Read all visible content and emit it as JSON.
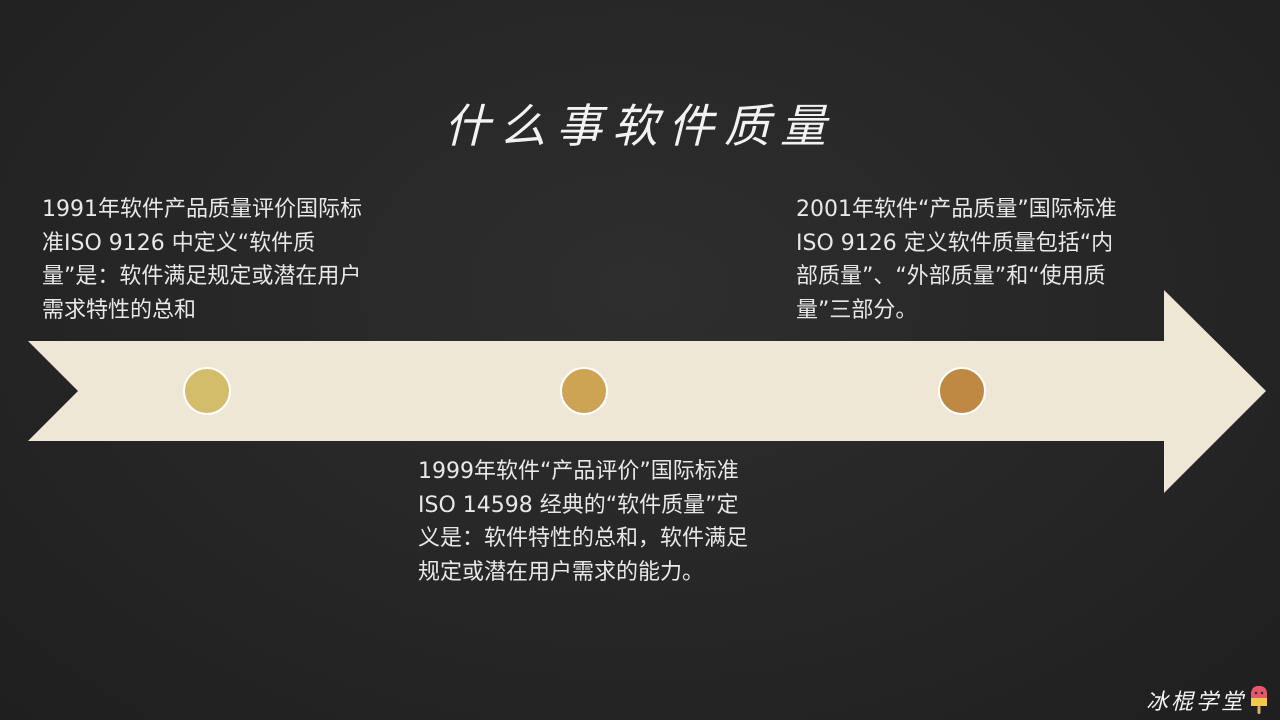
{
  "title": "什么事软件质量",
  "timeline": {
    "events": [
      {
        "text": "1991年软件产品质量评价国际标准ISO 9126 中定义“软件质量”是：软件满足规定或潜在用户需求特性的总和",
        "dot_color": "#d4bd6a"
      },
      {
        "text": "1999年软件“产品评价”国际标准ISO 14598 经典的“软件质量”定义是：软件特性的总和，软件满足规定或潜在用户需求的能力。",
        "dot_color": "#cda354"
      },
      {
        "text": "2001年软件“产品质量”国际标准ISO 9126 定义软件质量包括“内部质量”、“外部质量”和“使用质量”三部分。",
        "dot_color": "#bf8843"
      }
    ],
    "arrow_color": "#efe7d6"
  },
  "logo": {
    "text": "冰棍学堂",
    "icon": "popsicle-icon"
  }
}
